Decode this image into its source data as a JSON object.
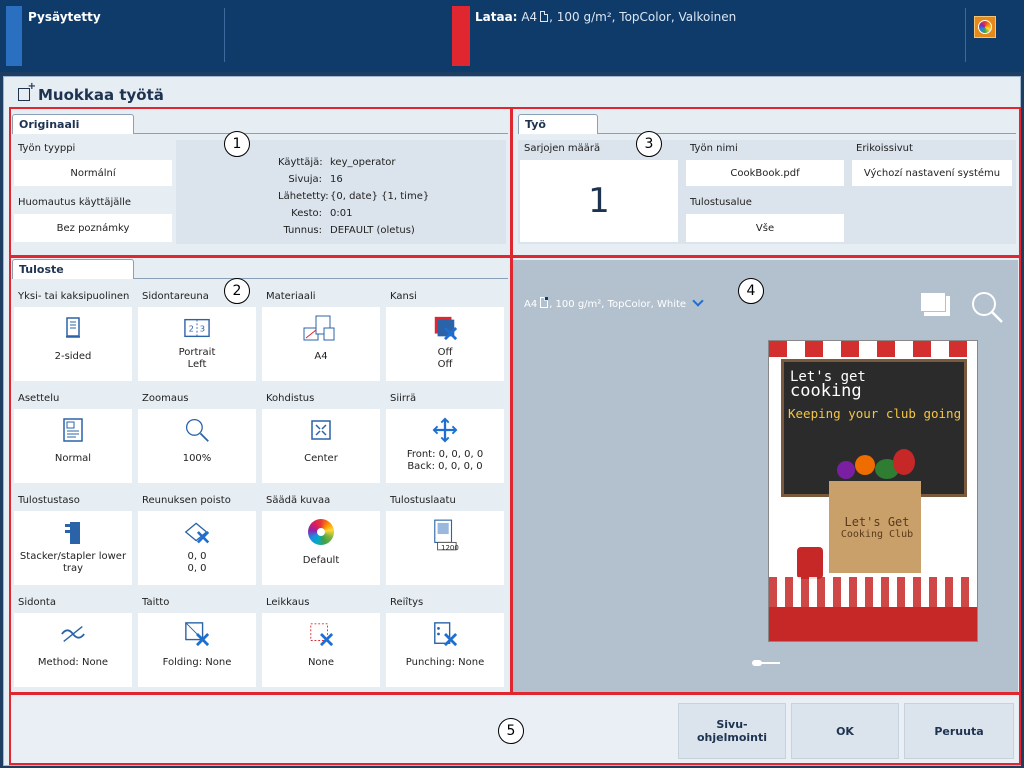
{
  "topbar": {
    "status": "Pysäytetty",
    "load_label": "Lataa:",
    "load_size": "A4",
    "load_details": ", 100 g/m², TopColor, Valkoinen",
    "colors": {
      "bar": "#0f3b6b",
      "status_accent": "#2a6fc0",
      "alert_accent": "#e0262e"
    }
  },
  "dialog": {
    "title": "Muokkaa työtä"
  },
  "annotations": [
    "1",
    "2",
    "3",
    "4",
    "5"
  ],
  "original": {
    "tab": "Originaali",
    "job_type_label": "Työn tyyppi",
    "job_type_value": "Normální",
    "note_label": "Huomautus käyttäjälle",
    "note_value": "Bez poznámky",
    "info": [
      {
        "key": "Käyttäjä:",
        "value": "key_operator"
      },
      {
        "key": "Sivuja:",
        "value": "16"
      },
      {
        "key": "Lähetetty:",
        "value": "{0, date} {1, time}"
      },
      {
        "key": "Kesto:",
        "value": "0:01"
      },
      {
        "key": "Tunnus:",
        "value": "DEFAULT (oletus)"
      }
    ]
  },
  "job": {
    "tab": "Työ",
    "sets_label": "Sarjojen määrä",
    "sets_value": "1",
    "name_label": "Työn nimi",
    "name_value": "CookBook.pdf",
    "print_range_label": "Tulostusalue",
    "print_range_value": "Vše",
    "special_pages_label": "Erikoissivut",
    "special_pages_value": "Výchozí nastavení systému"
  },
  "output": {
    "tab": "Tuloste",
    "tiles": [
      {
        "label": "Yksi- tai kaksipuolinen",
        "value": "2-sided",
        "icon": "duplex-icon"
      },
      {
        "label": "Sidontareuna",
        "value": "Portrait\nLeft",
        "icon": "binding-edge-icon"
      },
      {
        "label": "Materiaali",
        "value": "A4",
        "icon": "media-icon"
      },
      {
        "label": "Kansi",
        "value": "Off\nOff",
        "icon": "cover-off-icon"
      },
      {
        "label": "Asettelu",
        "value": "Normal",
        "icon": "layout-icon"
      },
      {
        "label": "Zoomaus",
        "value": "100%",
        "icon": "zoom-icon"
      },
      {
        "label": "Kohdistus",
        "value": "Center",
        "icon": "alignment-icon"
      },
      {
        "label": "Siirrä",
        "value": "Front: 0, 0, 0, 0\nBack: 0, 0, 0, 0",
        "icon": "shift-icon"
      },
      {
        "label": "Tulostustaso",
        "value": "Stacker/stapler lower\ntray",
        "icon": "output-tray-icon"
      },
      {
        "label": "Reunuksen poisto",
        "value": "0, 0\n0, 0",
        "icon": "edge-delete-icon"
      },
      {
        "label": "Säädä kuvaa",
        "value": "Default",
        "icon": "color-wheel-icon"
      },
      {
        "label": "Tulostuslaatu",
        "value": "",
        "icon": "print-quality-icon"
      },
      {
        "label": "Sidonta",
        "value": "Method: None",
        "icon": "binding-icon"
      },
      {
        "label": "Taitto",
        "value": "Folding: None",
        "icon": "folding-icon"
      },
      {
        "label": "Leikkaus",
        "value": "None",
        "icon": "trimming-icon"
      },
      {
        "label": "Reiîtys",
        "value": "Punching: None",
        "icon": "punching-icon"
      }
    ],
    "quality_badge": "1200"
  },
  "preview": {
    "media_size": "A4",
    "media_details": ", 100 g/m², TopColor, White",
    "poster_title_1": "Let's get",
    "poster_title_2": "cooking",
    "poster_subtitle": "Keeping your club going",
    "poster_box_1": "Let's Get",
    "poster_box_2": "Cooking Club"
  },
  "footer": {
    "page_programming": "Sivu-\nohjelmointi",
    "ok": "OK",
    "cancel": "Peruuta"
  }
}
